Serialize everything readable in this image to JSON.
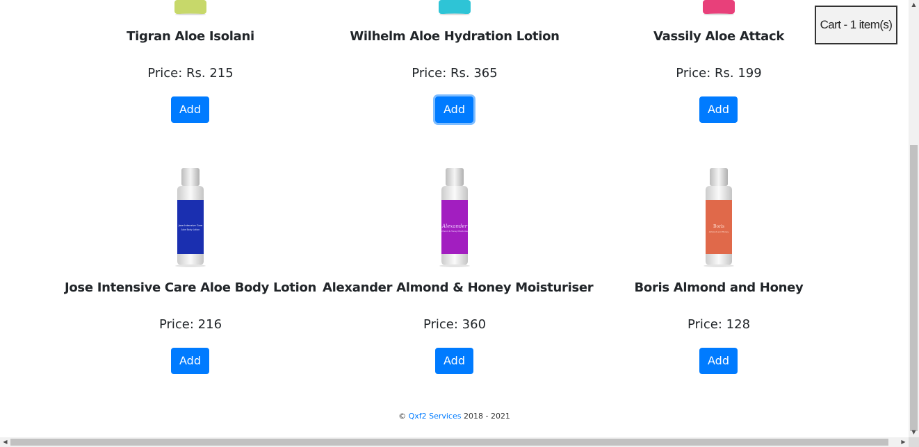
{
  "cart": {
    "label": "Cart - 1 item(s)"
  },
  "products": [
    {
      "name": "Tigran Aloe Isolani",
      "price": "Price: Rs. 215",
      "button": "Add",
      "color": "#c7d86a"
    },
    {
      "name": "Wilhelm Aloe Hydration Lotion",
      "price": "Price: Rs. 365",
      "button": "Add",
      "color": "#2ec4d6"
    },
    {
      "name": "Vassily Aloe Attack",
      "price": "Price: Rs. 199",
      "button": "Add",
      "color": "#e8407a"
    },
    {
      "name": "Jose Intensive Care Aloe Body Lotion",
      "price": "Price: 216",
      "button": "Add",
      "color": "#1a2fb0",
      "label_line1": "Jose Intensive Care",
      "label_line2": "Aloe Body Lotion"
    },
    {
      "name": "Alexander Almond & Honey Moisturiser",
      "price": "Price: 360",
      "button": "Add",
      "color": "#a21ec0",
      "label_line1": "Alexander",
      "label_line2": "Almond & Honey Moisturiser"
    },
    {
      "name": "Boris Almond and Honey",
      "price": "Price: 128",
      "button": "Add",
      "color": "#e0694a",
      "label_line1": "Boris",
      "label_line2": "Almond and Honey"
    }
  ],
  "footer": {
    "copyright": "©",
    "link": "Qxf2 Services",
    "years": "2018 - 2021"
  },
  "colors": {
    "accent": "#007bff"
  }
}
